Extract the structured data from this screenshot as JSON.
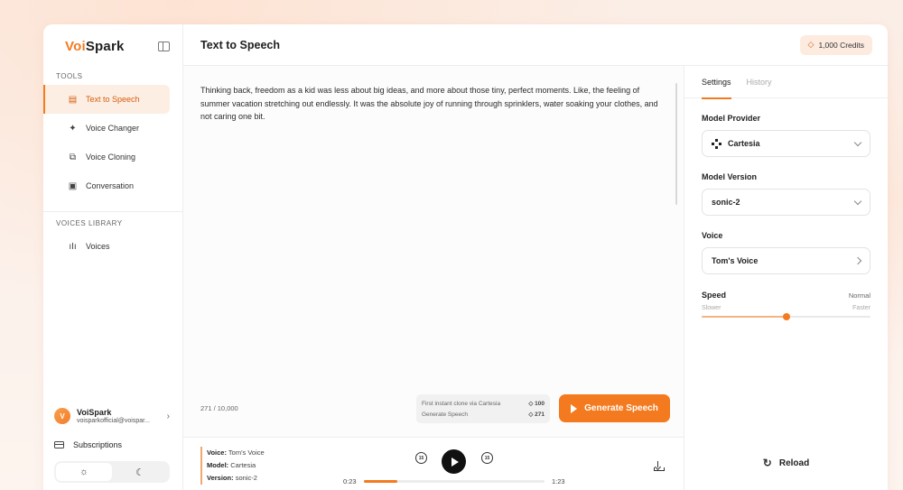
{
  "brand": {
    "part1": "Voi",
    "part2": "Spark"
  },
  "sidebar": {
    "tools_label": "TOOLS",
    "tools": [
      {
        "label": "Text to Speech",
        "icon": "document-voice-icon",
        "active": true
      },
      {
        "label": "Voice Changer",
        "icon": "sparkle-wave-icon",
        "active": false
      },
      {
        "label": "Voice Cloning",
        "icon": "clone-icon",
        "active": false
      },
      {
        "label": "Conversation",
        "icon": "chat-bubble-icon",
        "active": false
      }
    ],
    "library_label": "VOICES LIBRARY",
    "library": [
      {
        "label": "Voices",
        "icon": "waveform-icon"
      }
    ],
    "user": {
      "initial": "V",
      "name": "VoiSpark",
      "email": "voisparkofficial@voispar..."
    },
    "subscriptions_label": "Subscriptions"
  },
  "header": {
    "title": "Text to Speech",
    "credits": "1,000 Credits"
  },
  "editor": {
    "text": "Thinking back, freedom as a kid was less about big ideas, and more about those tiny, perfect moments. Like, the feeling of summer vacation stretching out endlessly. It was the absolute joy of running through sprinklers, water soaking your clothes, and not caring one bit.",
    "char_count": "271 / 10,000",
    "cost": [
      {
        "label": "First instant clone via Cartesia",
        "value": "100"
      },
      {
        "label": "Generate Speech",
        "value": "271"
      }
    ],
    "generate_label": "Generate Speech"
  },
  "player": {
    "voice_key": "Voice:",
    "voice_val": "Tom's Voice",
    "model_key": "Model:",
    "model_val": "Cartesia",
    "version_key": "Version:",
    "version_val": "sonic-2",
    "skip_back": "15",
    "skip_fwd": "15",
    "current_time": "0:23",
    "total_time": "1:23",
    "progress": 0.185
  },
  "settings": {
    "tabs": [
      "Settings",
      "History"
    ],
    "provider_label": "Model Provider",
    "provider_value": "Cartesia",
    "version_label": "Model Version",
    "version_value": "sonic-2",
    "voice_label": "Voice",
    "voice_value": "Tom's Voice",
    "speed_label": "Speed",
    "speed_value": "Normal",
    "speed_min_label": "Slower",
    "speed_max_label": "Faster",
    "speed_level": 0.5,
    "reload_label": "Reload"
  },
  "colors": {
    "accent": "#f47a1f",
    "accent_soft": "#fdeee3"
  }
}
